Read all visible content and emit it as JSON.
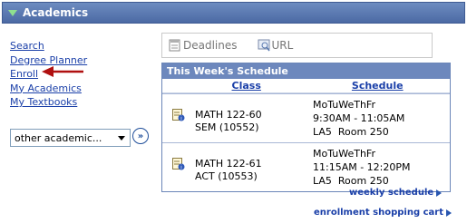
{
  "header": {
    "title": "Academics"
  },
  "left_links": [
    "Search",
    "Degree Planner",
    "Enroll",
    "My Academics",
    "My Textbooks"
  ],
  "other_select": {
    "value": "other academic..."
  },
  "go_button": {
    "label": "»"
  },
  "tabs": [
    {
      "label": "Deadlines",
      "icon": "deadlines-icon"
    },
    {
      "label": "URL",
      "icon": "url-icon"
    }
  ],
  "schedule": {
    "title": "This Week's Schedule",
    "columns": [
      "Class",
      "Schedule"
    ],
    "rows": [
      {
        "class_line1": "MATH 122-60",
        "class_line2": "SEM (10552)",
        "days": "MoTuWeThFr",
        "time": "9:30AM - 11:05AM",
        "location": "LA5  Room 250"
      },
      {
        "class_line1": "MATH 122-61",
        "class_line2": "ACT (10553)",
        "days": "MoTuWeThFr",
        "time": "11:15AM - 12:20PM",
        "location": "LA5  Room 250"
      }
    ]
  },
  "bottom_links": {
    "weekly": "weekly schedule",
    "cart": "enrollment shopping cart"
  },
  "colors": {
    "header": "#4c6aa4",
    "link": "#1a3fa8",
    "arrow": "#b01010"
  }
}
